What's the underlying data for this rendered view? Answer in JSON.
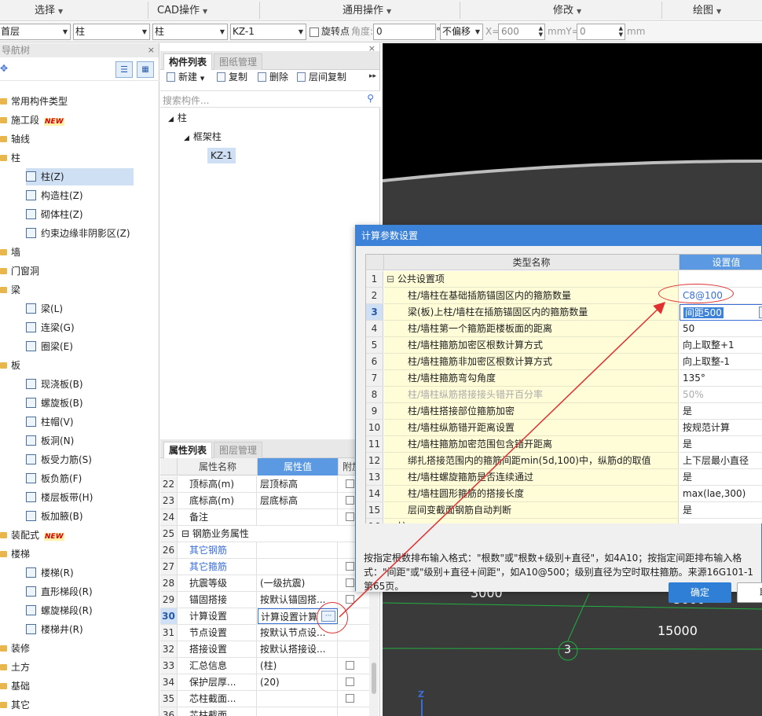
{
  "menu": {
    "items": [
      "选择",
      "CAD操作",
      "通用操作",
      "修改",
      "绘图"
    ]
  },
  "toolbar": {
    "floor": "首层",
    "category": "柱",
    "type": "柱",
    "component": "KZ-1",
    "rotate_label": "旋转点",
    "angle_label": "角度:",
    "angle_value": "0",
    "degree": "°",
    "offset_mode": "不偏移",
    "x_label": "X=",
    "x_value": "600",
    "mmy_label": "mmY=",
    "y_value": "0",
    "mm_label": "mm"
  },
  "nav": {
    "title": "导航树",
    "badge": "NEW",
    "items": [
      {
        "label": "常用构件类型",
        "level": 0
      },
      {
        "label": "施工段",
        "level": 0,
        "new": true
      },
      {
        "label": "轴线",
        "level": 0
      },
      {
        "label": "柱",
        "level": 0
      },
      {
        "label": "柱(Z)",
        "level": 1,
        "selected": true
      },
      {
        "label": "构造柱(Z)",
        "level": 1
      },
      {
        "label": "砌体柱(Z)",
        "level": 1
      },
      {
        "label": "约束边缘非阴影区(Z)",
        "level": 1
      },
      {
        "label": "墙",
        "level": 0
      },
      {
        "label": "门窗洞",
        "level": 0
      },
      {
        "label": "梁",
        "level": 0
      },
      {
        "label": "梁(L)",
        "level": 1
      },
      {
        "label": "连梁(G)",
        "level": 1
      },
      {
        "label": "圈梁(E)",
        "level": 1
      },
      {
        "label": "板",
        "level": 0
      },
      {
        "label": "现浇板(B)",
        "level": 1
      },
      {
        "label": "螺旋板(B)",
        "level": 1
      },
      {
        "label": "柱帽(V)",
        "level": 1
      },
      {
        "label": "板洞(N)",
        "level": 1
      },
      {
        "label": "板受力筋(S)",
        "level": 1
      },
      {
        "label": "板负筋(F)",
        "level": 1
      },
      {
        "label": "楼层板带(H)",
        "level": 1
      },
      {
        "label": "板加腋(B)",
        "level": 1
      },
      {
        "label": "装配式",
        "level": 0,
        "new": true
      },
      {
        "label": "楼梯",
        "level": 0
      },
      {
        "label": "楼梯(R)",
        "level": 1
      },
      {
        "label": "直形梯段(R)",
        "level": 1
      },
      {
        "label": "螺旋梯段(R)",
        "level": 1
      },
      {
        "label": "楼梯井(R)",
        "level": 1
      },
      {
        "label": "装修",
        "level": 0
      },
      {
        "label": "土方",
        "level": 0
      },
      {
        "label": "基础",
        "level": 0
      },
      {
        "label": "其它",
        "level": 0
      }
    ]
  },
  "component_panel": {
    "tab_active": "构件列表",
    "tab_other": "图纸管理",
    "btn_new": "新建",
    "btn_copy": "复制",
    "btn_delete": "删除",
    "btn_floor_copy": "层间复制",
    "search_placeholder": "搜索构件...",
    "tree_root": "柱",
    "tree_group": "框架柱",
    "tree_leaf": "KZ-1"
  },
  "property_panel": {
    "tab_active": "属性列表",
    "tab_other": "图层管理",
    "col_name": "属性名称",
    "col_value": "属性值",
    "col_extra": "附加",
    "rows": [
      {
        "num": "22",
        "name": "顶标高(m)",
        "value": "层顶标高",
        "check": true
      },
      {
        "num": "23",
        "name": "底标高(m)",
        "value": "层底标高",
        "check": true
      },
      {
        "num": "24",
        "name": "备注",
        "value": "",
        "check": true
      },
      {
        "num": "25",
        "name": "钢筋业务属性",
        "value": "",
        "check": false,
        "group": true
      },
      {
        "num": "26",
        "name": "其它钢筋",
        "value": "",
        "check": false,
        "blue": true
      },
      {
        "num": "27",
        "name": "其它箍筋",
        "value": "",
        "check": true,
        "blue": true
      },
      {
        "num": "28",
        "name": "抗震等级",
        "value": "(一级抗震)",
        "check": true
      },
      {
        "num": "29",
        "name": "锚固搭接",
        "value": "按默认锚固搭...",
        "check": true
      },
      {
        "num": "30",
        "name": "计算设置",
        "value": "计算设置计算",
        "check": false,
        "selected": true
      },
      {
        "num": "31",
        "name": "节点设置",
        "value": "按默认节点设...",
        "check": false
      },
      {
        "num": "32",
        "name": "搭接设置",
        "value": "按默认搭接设...",
        "check": false
      },
      {
        "num": "33",
        "name": "汇总信息",
        "value": "(柱)",
        "check": true
      },
      {
        "num": "34",
        "name": "保护层厚...",
        "value": "(20)",
        "check": true
      },
      {
        "num": "35",
        "name": "芯柱截面...",
        "value": "",
        "check": true
      },
      {
        "num": "36",
        "name": "芯柱截面...",
        "value": "",
        "check": false
      }
    ]
  },
  "viewport": {
    "label_3000_a": "3000",
    "label_3000_b": "3000",
    "label_15000": "15000",
    "axis_3": "3",
    "axis_z": "Z"
  },
  "dialog": {
    "title": "计算参数设置",
    "col_type": "类型名称",
    "col_value": "设置值",
    "rows": [
      {
        "num": "1",
        "name": "公共设置项",
        "value": "",
        "group": true
      },
      {
        "num": "2",
        "name": "柱/墙柱在基础插筋锚固区内的箍筋数量",
        "value": "C8@100",
        "blue": true
      },
      {
        "num": "3",
        "name": "梁(板)上柱/墙柱在插筋锚固区内的箍筋数量",
        "value": "间距500",
        "current": true
      },
      {
        "num": "4",
        "name": "柱/墙柱第一个箍筋距楼板面的距离",
        "value": "50"
      },
      {
        "num": "5",
        "name": "柱/墙柱箍筋加密区根数计算方式",
        "value": "向上取整+1"
      },
      {
        "num": "6",
        "name": "柱/墙柱箍筋非加密区根数计算方式",
        "value": "向上取整-1"
      },
      {
        "num": "7",
        "name": "柱/墙柱箍筋弯勾角度",
        "value": "135°"
      },
      {
        "num": "8",
        "name": "柱/墙柱纵筋搭接接头错开百分率",
        "value": "50%",
        "disabled": true
      },
      {
        "num": "9",
        "name": "柱/墙柱搭接部位箍筋加密",
        "value": "是"
      },
      {
        "num": "10",
        "name": "柱/墙柱纵筋错开距离设置",
        "value": "按规范计算"
      },
      {
        "num": "11",
        "name": "柱/墙柱箍筋加密范围包含错开距离",
        "value": "是"
      },
      {
        "num": "12",
        "name": "绑扎搭接范围内的箍筋间距min(5d,100)中，纵筋d的取值",
        "value": "上下层最小直径"
      },
      {
        "num": "13",
        "name": "柱/墙柱螺旋箍筋是否连续通过",
        "value": "是"
      },
      {
        "num": "14",
        "name": "柱/墙柱圆形箍筋的搭接长度",
        "value": "max(lae,300)"
      },
      {
        "num": "15",
        "name": "层间变截面钢筋自动判断",
        "value": "是"
      },
      {
        "num": "16",
        "name": "柱",
        "value": "",
        "group": true
      }
    ],
    "hint": "按指定根数排布输入格式：\"根数\"或\"根数+级别+直径\"，如4A10；按指定间距排布输入格式：\"间距\"或\"级别+直径+间距\"，如A10@500；级别直径为空时取柱箍筋。来源16G101-1第65页。",
    "ok": "确定",
    "cancel": "取消"
  },
  "colors": {
    "accent": "#3b82d8",
    "annotation": "#e03030",
    "selected_bg": "#cfe0f4"
  }
}
